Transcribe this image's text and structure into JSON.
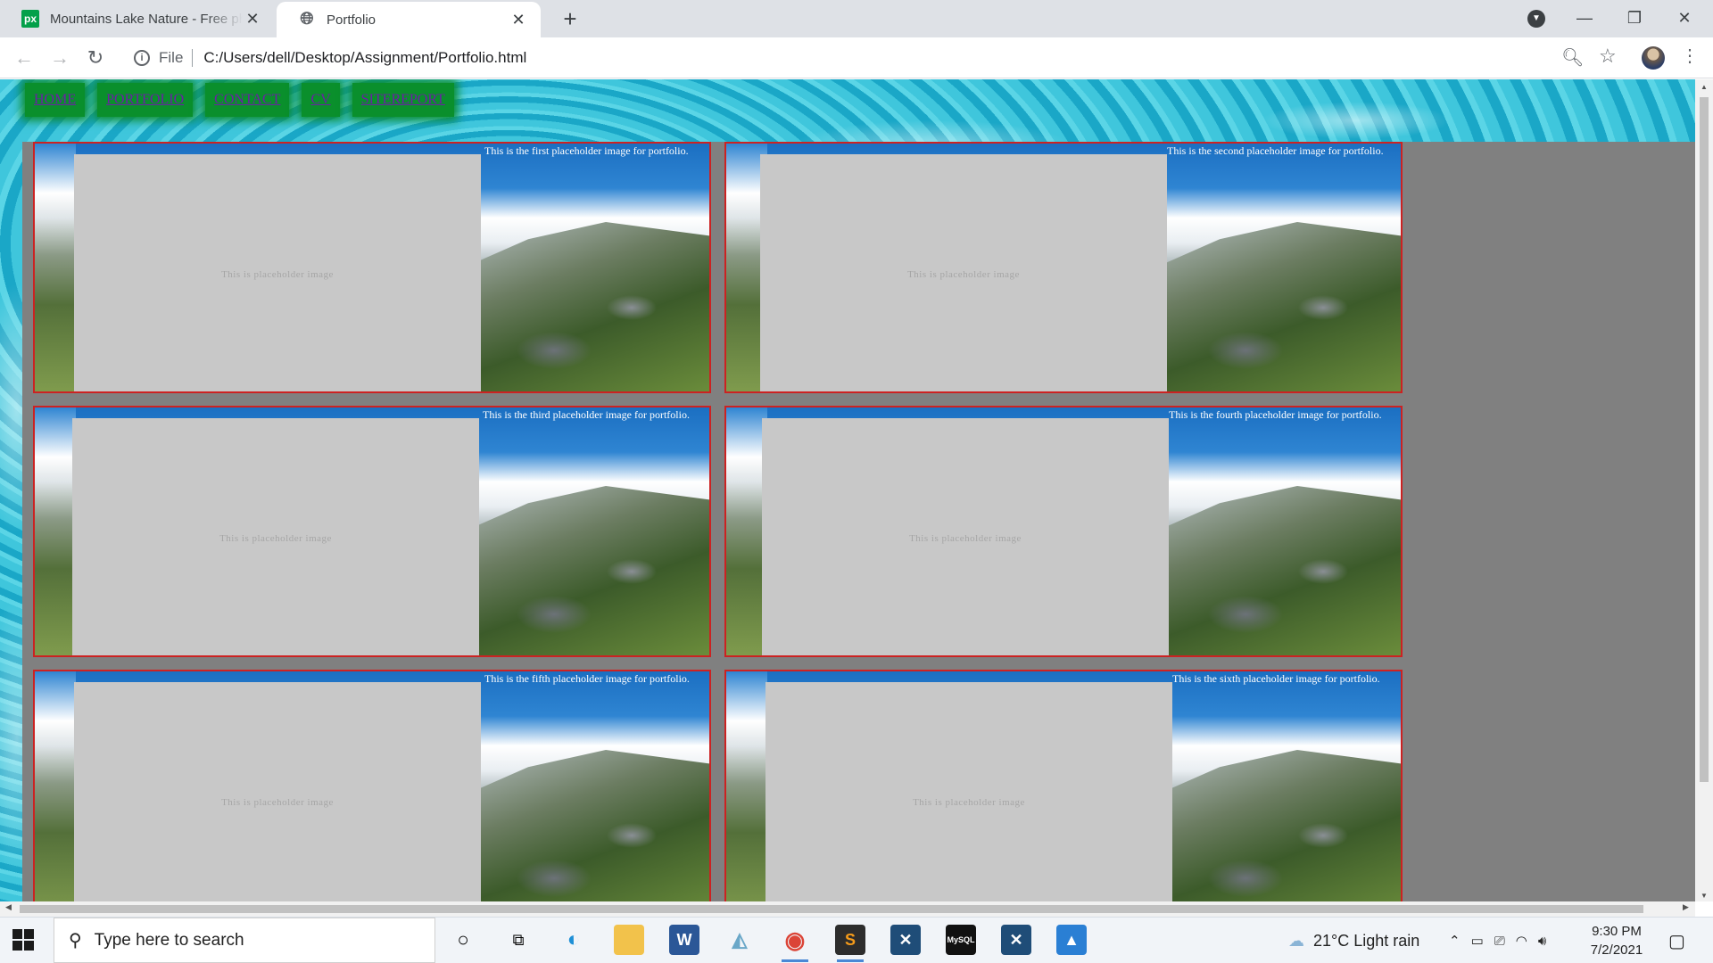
{
  "browser": {
    "tabs": [
      {
        "title": "Mountains Lake Nature - Free photo",
        "favicon": "px-icon",
        "active": false
      },
      {
        "title": "Portfolio",
        "favicon": "globe-icon",
        "active": true
      }
    ],
    "address": {
      "scheme_label": "File",
      "url": "C:/Users/dell/Desktop/Assignment/Portfolio.html"
    }
  },
  "page": {
    "nav": [
      "HOME",
      "PORTFOLIO",
      "CONTACT",
      "CV",
      "SITEREPORT"
    ],
    "placeholder_text": "This is placeholder image",
    "cards": [
      {
        "caption": "This is the first placeholder image for portfolio."
      },
      {
        "caption": "This is the second placeholder image for portfolio."
      },
      {
        "caption": "This is the third placeholder image for portfolio."
      },
      {
        "caption": "This is the fourth placeholder image for portfolio."
      },
      {
        "caption": "This is the fifth placeholder image for portfolio."
      },
      {
        "caption": "This is the sixth placeholder image for portfolio."
      }
    ]
  },
  "taskbar": {
    "search_placeholder": "Type here to search",
    "weather": "21°C  Light rain",
    "time": "9:30 PM",
    "date": "7/2/2021"
  },
  "colors": {
    "nav_bg": "#0a8f2c",
    "content_bg": "#808080",
    "card_border": "#cc2222",
    "placeholder_bg": "#c8c8c8"
  }
}
